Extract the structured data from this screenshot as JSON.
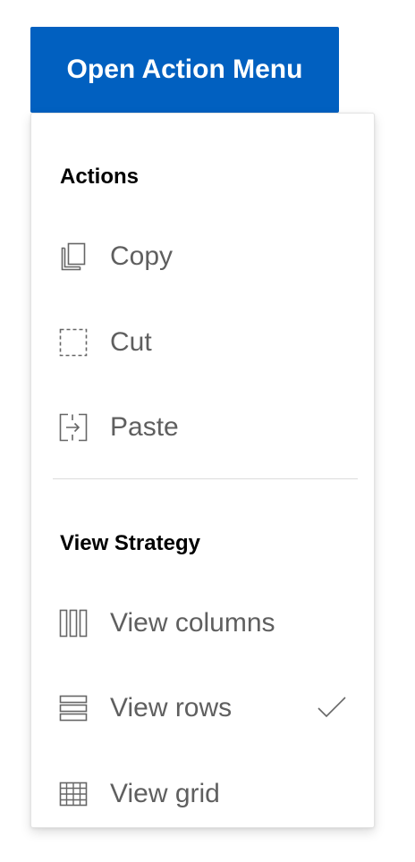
{
  "trigger": {
    "label": "Open Action Menu"
  },
  "menu": {
    "groups": [
      {
        "title": "Actions",
        "items": [
          {
            "label": "Copy",
            "icon": "copy-icon"
          },
          {
            "label": "Cut",
            "icon": "cut-icon"
          },
          {
            "label": "Paste",
            "icon": "paste-icon"
          }
        ]
      },
      {
        "title": "View Strategy",
        "items": [
          {
            "label": "View columns",
            "icon": "view-columns-icon",
            "selected": false
          },
          {
            "label": "View rows",
            "icon": "view-rows-icon",
            "selected": true
          },
          {
            "label": "View grid",
            "icon": "view-grid-icon",
            "selected": false
          }
        ]
      }
    ]
  },
  "colors": {
    "trigger_background": "#0160c0",
    "trigger_text": "#ffffff",
    "item_text": "#5f5f5f",
    "group_title_text": "#000000",
    "icon_stroke": "#666666"
  }
}
